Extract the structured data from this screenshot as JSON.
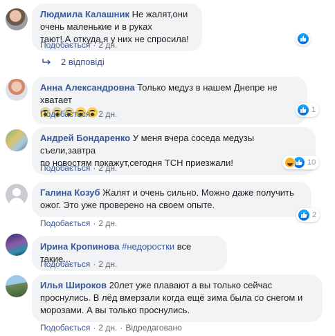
{
  "comments": [
    {
      "author": "Людмила Калашник",
      "text_line1": "Не жалят,они очень маленькие и в руках",
      "text_line2": "тают! А откуда,я у них не спросила!",
      "like_label": "Подобається",
      "time": "2 дн.",
      "reaction_count": ""
    },
    {
      "author": "Анна Александровна",
      "text_line1": "Только медуз в нашем Днепре не хватает",
      "like_label": "Подобається",
      "time": "2 дн.",
      "reaction_count": "1",
      "emoji_count": 5
    },
    {
      "author": "Андрей Бондаренко",
      "text_line1": "У меня вчера соседа медузы съели,завтра",
      "text_line2": "по новостям покажут,сегодня ТСН приезжали!",
      "like_label": "Подобається",
      "time": "2 дн.",
      "reaction_count": "10"
    },
    {
      "author": "Галина Козуб",
      "text_line1": "Жалят и очень сильно. Можно даже получить",
      "text_line2": "ожог. Это уже проверено на своем опыте.",
      "like_label": "Подобається",
      "time": "2 дн.",
      "reaction_count": "2"
    },
    {
      "author": "Ирина Кропинова",
      "hashtag": "#недоростки",
      "text_line1": "все такие...",
      "like_label": "Подобається",
      "time": "2 дн."
    },
    {
      "author": "Илья Широков",
      "text_line1": "20лет уже плавают а вы только сейчас",
      "text_line2": "проснулись. В лёд вмерзали когда ещё зима была со снегом и",
      "text_line3": "морозами. А вы только проснулись.",
      "like_label": "Подобається",
      "time": "2 дн.",
      "edited_label": "Відредаговано"
    }
  ],
  "replies_label": "2 відповіді",
  "colors": {
    "link": "#385898",
    "bubble": "#f2f3f5",
    "meta": "#606770",
    "like": "#1877f2"
  }
}
